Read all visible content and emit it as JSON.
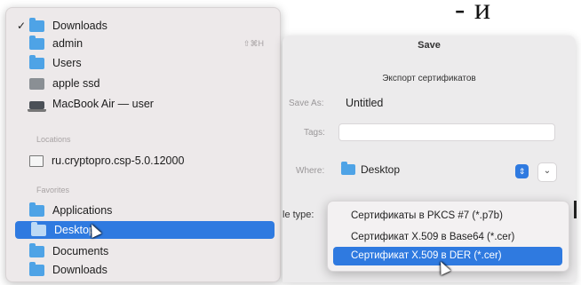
{
  "doc_fragment": "‑ и",
  "locations_menu": {
    "items": [
      {
        "label": "Downloads",
        "icon": "folder-icon",
        "checked": true
      },
      {
        "label": "admin",
        "icon": "folder-icon",
        "shortcut": "⇧⌘H"
      },
      {
        "label": "Users",
        "icon": "folder-icon"
      },
      {
        "label": "apple ssd",
        "icon": "drive-icon"
      },
      {
        "label": "MacBook Air — user",
        "icon": "laptop-icon"
      }
    ],
    "section_locations": "Locations",
    "location_items": [
      {
        "label": "ru.cryptopro.csp-5.0.12000",
        "icon": "document-icon"
      }
    ],
    "section_favorites": "Favorites",
    "favorite_items": [
      {
        "label": "Applications",
        "icon": "folder-icon"
      },
      {
        "label": "Desktop",
        "icon": "folder-icon",
        "selected": true
      },
      {
        "label": "Documents",
        "icon": "folder-icon"
      },
      {
        "label": "Downloads",
        "icon": "folder-icon"
      }
    ]
  },
  "save_dialog": {
    "title": "Save",
    "subtitle": "Экспорт сертификатов",
    "save_as_label": "Save As:",
    "save_as_value": "Untitled",
    "tags_label": "Tags:",
    "tags_value": "",
    "where_label": "Where:",
    "where_value": "Desktop",
    "file_type_label": "le type:",
    "file_type_options": [
      {
        "label": "Сертификаты в PKCS #7 (*.p7b)"
      },
      {
        "label": "Сертификат X.509 в Base64 (*.cer)"
      },
      {
        "label": "Сертификат X.509 в DER (*.cer)",
        "selected": true
      }
    ]
  },
  "colors": {
    "accent": "#2f7ae0",
    "folder": "#4ea3e6",
    "menu_bg": "#ede9ea",
    "dialog_bg": "#ecebec"
  }
}
